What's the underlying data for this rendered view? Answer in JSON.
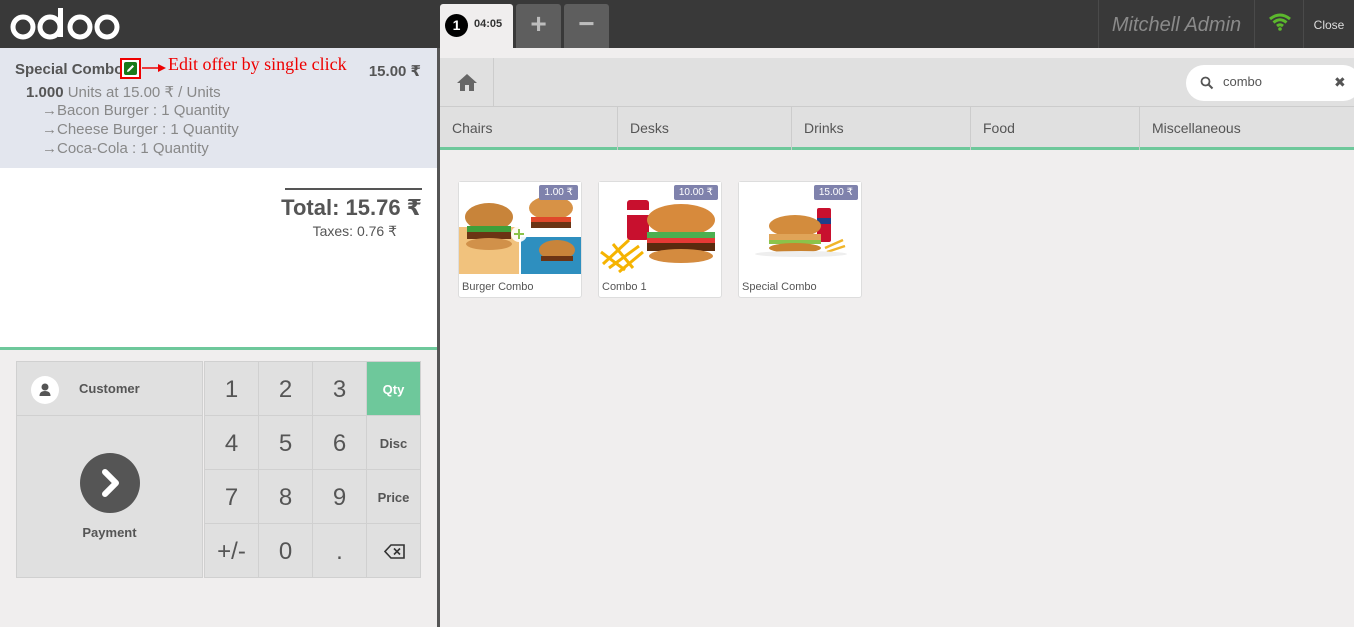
{
  "header": {
    "order_number": "1",
    "order_time": "04:05",
    "add_order": "+",
    "remove_order": "−",
    "user": "Mitchell Admin",
    "close": "Close"
  },
  "orderline": {
    "name": "Special Combo",
    "annotation": "Edit offer by single click",
    "price": "15.00 ₹",
    "qty": "1.000",
    "info": "Units at 15.00 ₹ / Units",
    "sub_items": [
      "→Bacon Burger : 1 Quantity",
      "→Cheese Burger : 1 Quantity",
      "→Coca-Cola : 1 Quantity"
    ]
  },
  "summary": {
    "total": "Total: 15.76 ₹",
    "taxes": "Taxes: 0.76 ₹"
  },
  "pad": {
    "customer": "Customer",
    "payment": "Payment",
    "keys": [
      "1",
      "2",
      "3",
      "4",
      "5",
      "6",
      "7",
      "8",
      "9",
      "+/-",
      "0",
      "."
    ],
    "modes": [
      "Qty",
      "Disc",
      "Price"
    ]
  },
  "search": {
    "value": "combo"
  },
  "categories": [
    "Chairs",
    "Desks",
    "Drinks",
    "Food",
    "Miscellaneous"
  ],
  "products": [
    {
      "name": "Burger Combo",
      "price": "1.00 ₹"
    },
    {
      "name": "Combo 1",
      "price": "10.00 ₹"
    },
    {
      "name": "Special Combo",
      "price": "15.00 ₹"
    }
  ],
  "colors": {
    "accent": "#6ec89b",
    "price_tag": "#7f82ac",
    "header": "#393939",
    "annotation": "#ee0000"
  }
}
